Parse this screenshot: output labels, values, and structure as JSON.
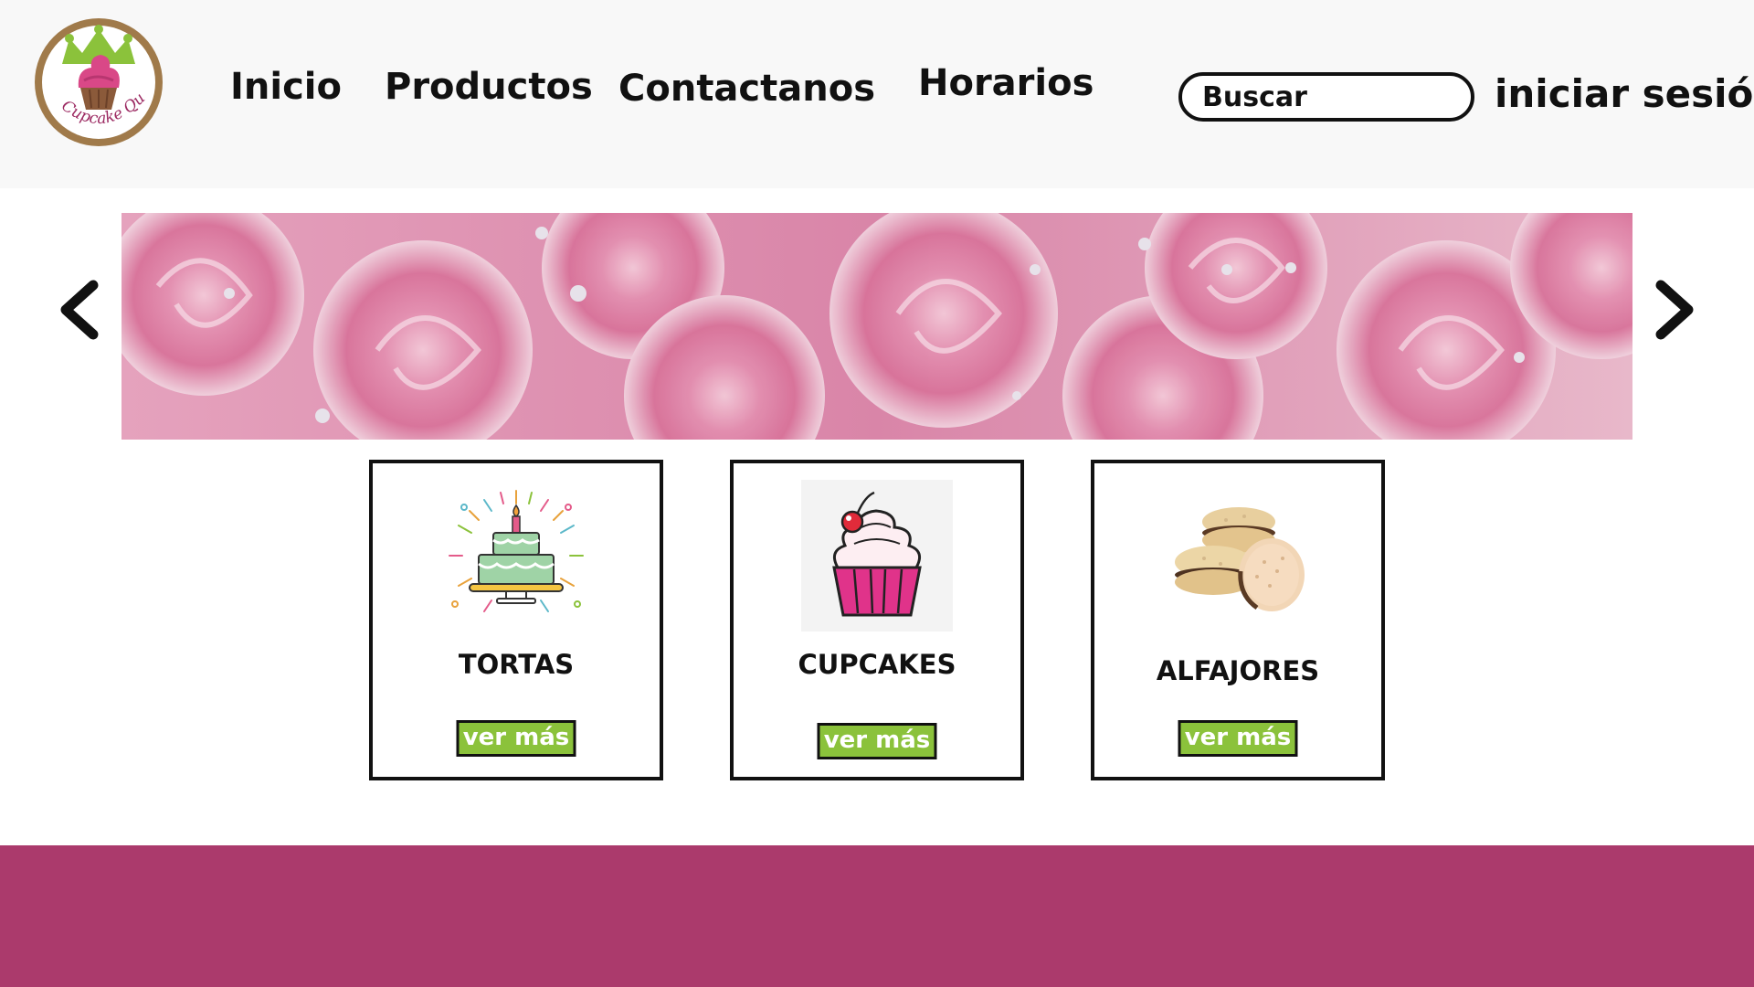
{
  "brand": {
    "logo_text": "Cupcake Queen"
  },
  "nav": {
    "items": [
      {
        "label": "Inicio"
      },
      {
        "label": "Productos"
      },
      {
        "label": "Contactanos"
      },
      {
        "label": "Horarios"
      }
    ]
  },
  "search": {
    "placeholder": "Buscar"
  },
  "login": {
    "label": "iniciar sesión"
  },
  "carousel": {
    "prev_icon": "chevron-left-icon",
    "next_icon": "chevron-right-icon"
  },
  "products": [
    {
      "title": "TORTAS",
      "button": "ver más",
      "icon": "cake-icon"
    },
    {
      "title": "CUPCAKES",
      "button": "ver más",
      "icon": "cupcake-icon"
    },
    {
      "title": "ALFAJORES",
      "button": "ver más",
      "icon": "alfajores-icon"
    }
  ],
  "colors": {
    "header_bg": "#f8f8f8",
    "button_green": "#8bc23b",
    "footer_magenta": "#ab3a6c",
    "logo_ring": "#a07a4a",
    "crown_green": "#8bc23b"
  }
}
